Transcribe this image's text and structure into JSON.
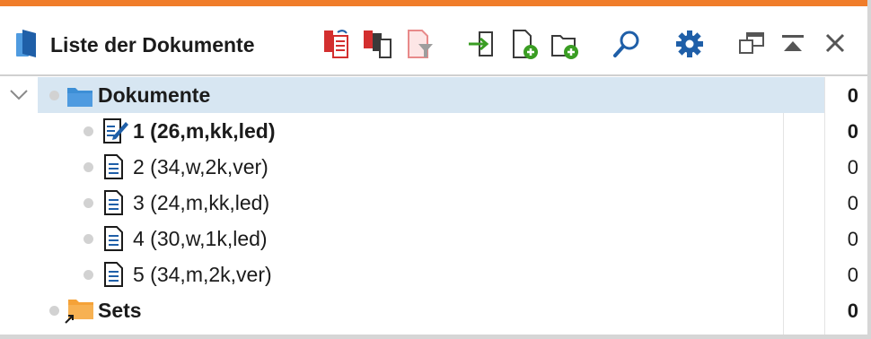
{
  "window": {
    "title": "Liste der Dokumente"
  },
  "toolbar": {
    "buttons": [
      {
        "name": "document-list-icon",
        "color": "#d32f2f"
      },
      {
        "name": "copy-documents-icon",
        "color": "#d32f2f"
      },
      {
        "name": "filter-icon",
        "color": "#e88a8a"
      },
      {
        "name": "import-icon",
        "color": "#3a9d23"
      },
      {
        "name": "new-document-icon",
        "color": "#3a9d23"
      },
      {
        "name": "new-document-group-icon",
        "color": "#3a9d23"
      },
      {
        "name": "search-icon",
        "color": "#1f5fa8"
      },
      {
        "name": "settings-icon",
        "color": "#1f5fa8"
      },
      {
        "name": "undock-window-icon",
        "color": "#555555"
      },
      {
        "name": "collapse-window-icon",
        "color": "#555555"
      },
      {
        "name": "close-icon",
        "color": "#555555"
      }
    ]
  },
  "tree": {
    "root": {
      "label": "Dokumente",
      "count": "0"
    },
    "documents": [
      {
        "label": "1 (26,m,kk,led)",
        "count": "0",
        "bold": true,
        "icon": "document-edit-icon"
      },
      {
        "label": "2 (34,w,2k,ver)",
        "count": "0",
        "bold": false,
        "icon": "document-icon"
      },
      {
        "label": "3 (24,m,kk,led)",
        "count": "0",
        "bold": false,
        "icon": "document-icon"
      },
      {
        "label": "4 (30,w,1k,led)",
        "count": "0",
        "bold": false,
        "icon": "document-icon"
      },
      {
        "label": "5 (34,m,2k,ver)",
        "count": "0",
        "bold": false,
        "icon": "document-icon"
      }
    ],
    "sets": {
      "label": "Sets",
      "count": "0"
    }
  },
  "colors": {
    "accent_bar": "#f07d2a",
    "selection": "#d7e6f2",
    "folder_blue": "#3d8fd6",
    "folder_orange": "#f5a238",
    "app_icon": "#1f5fa8"
  }
}
